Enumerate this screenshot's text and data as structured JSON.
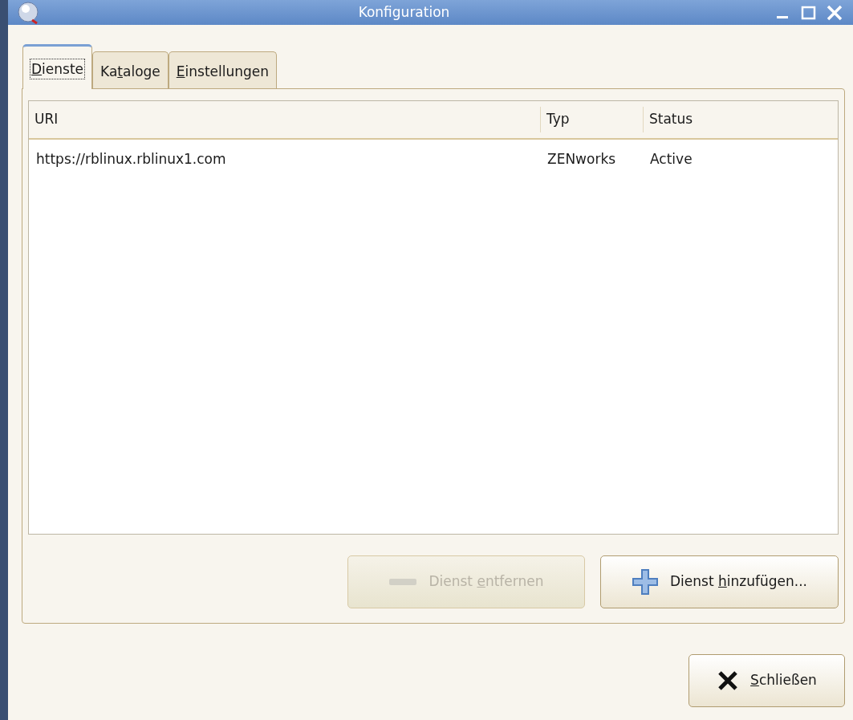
{
  "window": {
    "title": "Konfiguration"
  },
  "tabs": [
    {
      "label": [
        {
          "text": "D",
          "underline": true
        },
        {
          "text": "ienste"
        }
      ],
      "selected": true
    },
    {
      "label": [
        {
          "text": "Ka"
        },
        {
          "text": "t",
          "underline": true
        },
        {
          "text": "aloge"
        }
      ],
      "selected": false
    },
    {
      "label": [
        {
          "text": "E",
          "underline": true
        },
        {
          "text": "instellungen"
        }
      ],
      "selected": false
    }
  ],
  "table": {
    "columns": [
      "URI",
      "Typ",
      "Status"
    ],
    "rows": [
      [
        "https://rblinux.rblinux1.com",
        "ZENworks",
        "Active"
      ]
    ]
  },
  "buttons": [
    {
      "kind": "remove",
      "label": [
        {
          "text": "Dienst "
        },
        {
          "text": "e",
          "underline": true
        },
        {
          "text": "ntfernen"
        }
      ],
      "disabled": true
    },
    {
      "kind": "add",
      "label": [
        {
          "text": "Dienst "
        },
        {
          "text": "h",
          "underline": true
        },
        {
          "text": "inzufügen..."
        }
      ],
      "disabled": false
    }
  ],
  "close_button": {
    "kind": "close",
    "label": [
      {
        "text": "S",
        "underline": true
      },
      {
        "text": "chließen"
      }
    ],
    "disabled": false
  }
}
